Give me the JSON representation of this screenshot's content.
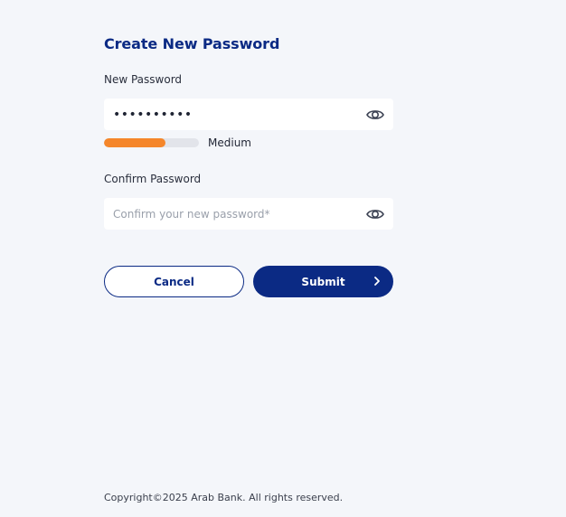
{
  "form": {
    "title": "Create New Password",
    "new_password": {
      "label": "New Password",
      "value": "••••••••••",
      "toggle_icon": "eye-icon"
    },
    "strength": {
      "level": 0.65,
      "label": "Medium",
      "color": "#f5862a"
    },
    "confirm_password": {
      "label": "Confirm Password",
      "placeholder": "Confirm your new password*",
      "value": "",
      "toggle_icon": "eye-icon"
    },
    "cancel_label": "Cancel",
    "submit_label": "Submit",
    "submit_icon": "chevron-right-icon"
  },
  "footer": {
    "copyright": "Copyright©2025 Arab Bank. All rights reserved."
  },
  "colors": {
    "background": "#f4f6fa",
    "brand": "#0b2a84",
    "strength_track": "#e2e4ea"
  }
}
